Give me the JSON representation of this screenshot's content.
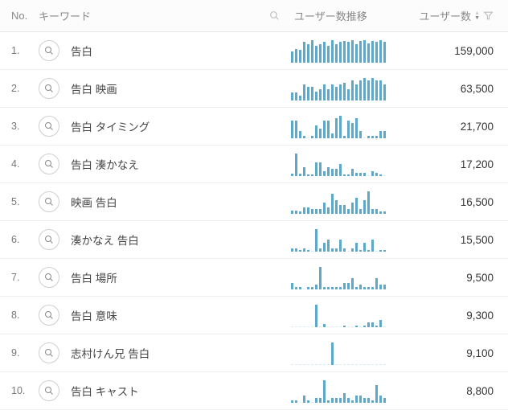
{
  "header": {
    "no": "No.",
    "keyword": "キーワード",
    "user_trend": "ユーザー数推移",
    "users": "ユーザー数"
  },
  "rows": [
    {
      "no": "1.",
      "keyword": "告白",
      "users": "159,000"
    },
    {
      "no": "2.",
      "keyword": "告白 映画",
      "users": "63,500"
    },
    {
      "no": "3.",
      "keyword": "告白 タイミング",
      "users": "21,700"
    },
    {
      "no": "4.",
      "keyword": "告白 湊かなえ",
      "users": "17,200"
    },
    {
      "no": "5.",
      "keyword": "映画 告白",
      "users": "16,500"
    },
    {
      "no": "6.",
      "keyword": "湊かなえ 告白",
      "users": "15,500"
    },
    {
      "no": "7.",
      "keyword": "告白 場所",
      "users": "9,500"
    },
    {
      "no": "8.",
      "keyword": "告白 意味",
      "users": "9,300"
    },
    {
      "no": "9.",
      "keyword": "志村けん兄 告白",
      "users": "9,100"
    },
    {
      "no": "10.",
      "keyword": "告白 キャスト",
      "users": "8,800"
    }
  ],
  "chart_data": [
    {
      "type": "bar",
      "values": [
        12,
        15,
        14,
        22,
        20,
        24,
        18,
        20,
        22,
        18,
        24,
        20,
        22,
        23,
        22,
        24,
        20,
        23,
        24,
        21,
        23,
        22,
        24,
        22
      ]
    },
    {
      "type": "bar",
      "values": [
        7,
        7,
        4,
        14,
        12,
        12,
        8,
        10,
        14,
        10,
        14,
        12,
        14,
        16,
        10,
        18,
        14,
        18,
        20,
        18,
        20,
        18,
        18,
        14
      ]
    },
    {
      "type": "bar",
      "values": [
        14,
        14,
        6,
        2,
        0,
        2,
        10,
        8,
        14,
        14,
        4,
        16,
        18,
        2,
        14,
        12,
        16,
        6,
        0,
        2,
        2,
        2,
        6,
        6
      ]
    },
    {
      "type": "bar",
      "values": [
        3,
        26,
        3,
        10,
        2,
        2,
        16,
        16,
        6,
        10,
        8,
        8,
        14,
        2,
        2,
        8,
        4,
        4,
        4,
        0,
        6,
        4,
        2,
        0
      ]
    },
    {
      "type": "bar",
      "values": [
        3,
        3,
        2,
        6,
        6,
        4,
        4,
        4,
        10,
        6,
        18,
        12,
        8,
        8,
        4,
        10,
        14,
        4,
        12,
        20,
        4,
        4,
        2,
        2
      ]
    },
    {
      "type": "bar",
      "values": [
        4,
        4,
        2,
        4,
        2,
        0,
        26,
        4,
        10,
        14,
        4,
        4,
        14,
        4,
        0,
        4,
        10,
        2,
        10,
        2,
        14,
        0,
        2,
        2
      ]
    },
    {
      "type": "bar",
      "values": [
        6,
        2,
        2,
        0,
        2,
        2,
        4,
        20,
        2,
        2,
        2,
        2,
        2,
        6,
        6,
        10,
        2,
        4,
        2,
        2,
        2,
        10,
        4,
        4
      ]
    },
    {
      "type": "bar",
      "values": [
        0,
        0,
        0,
        0,
        0,
        0,
        26,
        0,
        4,
        0,
        0,
        0,
        0,
        2,
        0,
        0,
        2,
        0,
        2,
        6,
        6,
        2,
        8,
        0
      ]
    },
    {
      "type": "bar",
      "values": [
        0,
        0,
        0,
        0,
        0,
        0,
        0,
        0,
        0,
        0,
        26,
        0,
        0,
        0,
        0,
        0,
        0,
        0,
        0,
        0,
        0,
        0,
        0,
        0
      ]
    },
    {
      "type": "bar",
      "values": [
        2,
        2,
        0,
        6,
        2,
        0,
        4,
        4,
        18,
        2,
        4,
        4,
        4,
        8,
        4,
        2,
        6,
        6,
        4,
        4,
        2,
        14,
        6,
        4
      ]
    }
  ]
}
